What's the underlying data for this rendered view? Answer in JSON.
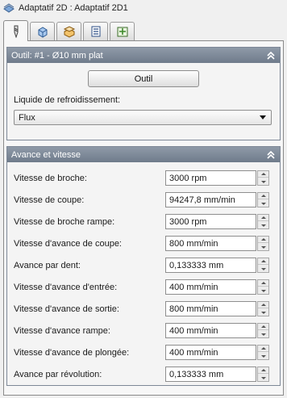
{
  "window": {
    "title": "Adaptatif 2D : Adaptatif 2D1"
  },
  "tabs": [
    {
      "icon": "tool-icon",
      "active": true
    },
    {
      "icon": "geometry-icon",
      "active": false
    },
    {
      "icon": "heights-icon",
      "active": false
    },
    {
      "icon": "passes-icon",
      "active": false
    },
    {
      "icon": "linking-icon",
      "active": false
    }
  ],
  "tool_panel": {
    "title": "Outil: #1 - Ø10 mm plat",
    "button_label": "Outil",
    "coolant_label": "Liquide de refroidissement:",
    "coolant_value": "Flux"
  },
  "feed_panel": {
    "title": "Avance et vitesse",
    "rows": [
      {
        "label": "Vitesse de broche:",
        "value": "3000 rpm"
      },
      {
        "label": "Vitesse de coupe:",
        "value": "94247,8 mm/min"
      },
      {
        "label": "Vitesse de broche rampe:",
        "value": "3000 rpm"
      },
      {
        "label": "Vitesse d'avance de coupe:",
        "value": "800 mm/min"
      },
      {
        "label": "Avance par dent:",
        "value": "0,133333 mm"
      },
      {
        "label": "Vitesse d'avance d'entrée:",
        "value": "400 mm/min"
      },
      {
        "label": "Vitesse d'avance de sortie:",
        "value": "800 mm/min"
      },
      {
        "label": "Vitesse d'avance rampe:",
        "value": "400 mm/min"
      },
      {
        "label": "Vitesse d'avance de plongée:",
        "value": "400 mm/min"
      },
      {
        "label": "Avance par révolution:",
        "value": "0,133333 mm"
      }
    ]
  },
  "colors": {
    "panel_header": "#7f8a99",
    "background": "#f0f0f0"
  }
}
